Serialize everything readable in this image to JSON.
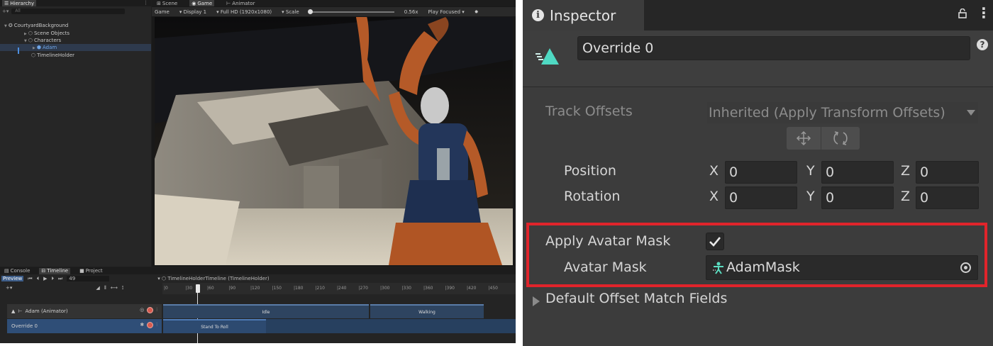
{
  "hierarchy": {
    "tab": "Hierarchy",
    "search_placeholder": "All",
    "items": [
      {
        "label": "CourtyardBackground"
      },
      {
        "label": "Scene Objects"
      },
      {
        "label": "Characters"
      },
      {
        "label": "Adam"
      },
      {
        "label": "TimelineHolder"
      }
    ]
  },
  "game_view": {
    "tabs": [
      "Scene",
      "Game",
      "Animator"
    ],
    "toolbar": {
      "mode": "Game",
      "display": "Display 1",
      "resolution": "Full HD (1920x1080)",
      "scale_label": "Scale",
      "scale_value": "0.56x",
      "play_mode": "Play Focused"
    }
  },
  "timeline": {
    "tabs": [
      "Console",
      "Timeline",
      "Project"
    ],
    "preview_label": "Preview",
    "frame": "49",
    "asset": "TimelineHolderTimeline (TimelineHolder)",
    "ruler_ticks": [
      "0",
      "30",
      "60",
      "90",
      "120",
      "150",
      "180",
      "210",
      "240",
      "270",
      "300",
      "330",
      "360",
      "390",
      "420",
      "450"
    ],
    "tracks": [
      {
        "label": "Adam (Animator)"
      },
      {
        "label": "Override 0"
      }
    ],
    "clips": {
      "idle": "Idle",
      "walking": "Walking",
      "stand_to_roll": "Stand To Roll"
    }
  },
  "inspector": {
    "tab": "Inspector",
    "object_name": "Override 0",
    "track_offsets_label": "Track Offsets",
    "track_offsets_value": "Inherited (Apply Transform Offsets)",
    "position_label": "Position",
    "rotation_label": "Rotation",
    "axis": {
      "x": "X",
      "y": "Y",
      "z": "Z"
    },
    "position": {
      "x": "0",
      "y": "0",
      "z": "0"
    },
    "rotation": {
      "x": "0",
      "y": "0",
      "z": "0"
    },
    "apply_avatar_mask_label": "Apply Avatar Mask",
    "apply_avatar_mask": true,
    "avatar_mask_label": "Avatar Mask",
    "avatar_mask_value": "AdamMask",
    "default_offset_match_fields": "Default Offset Match Fields"
  },
  "colors": {
    "highlight_box": "#e0242b",
    "clip_icon": "#4fd9c3",
    "avatar_icon": "#5bdcc0"
  }
}
